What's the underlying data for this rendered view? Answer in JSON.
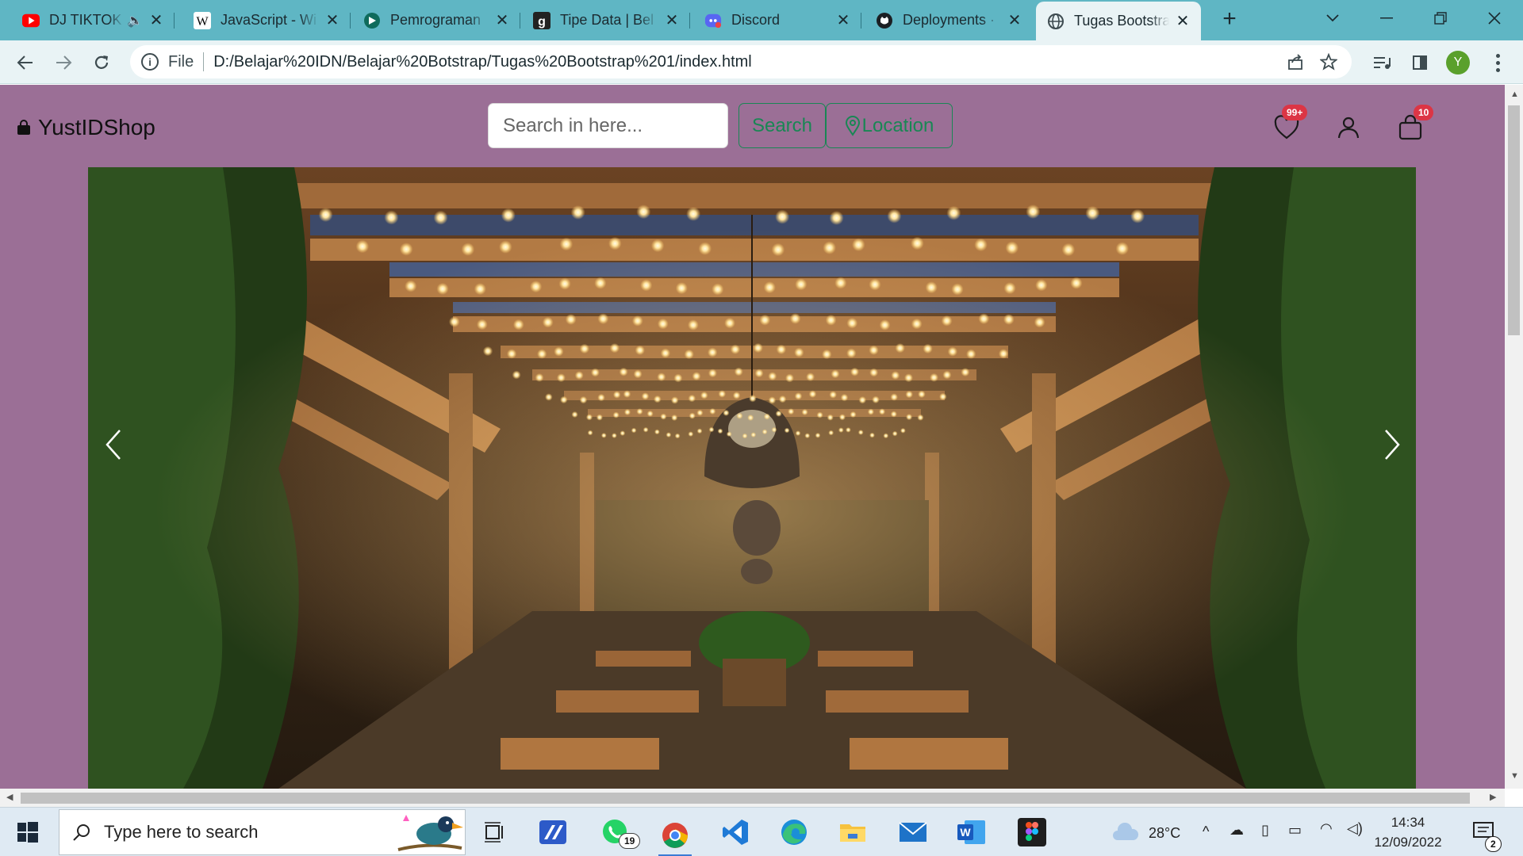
{
  "browser": {
    "tabs": [
      {
        "title": "DJ TIKTOK",
        "icon": "youtube-icon",
        "muted_indicator": true,
        "active": false
      },
      {
        "title": "JavaScript - Wi",
        "icon": "wikipedia-icon",
        "active": false
      },
      {
        "title": "Pemrograman",
        "icon": "teal-site-icon",
        "active": false
      },
      {
        "title": "Tipe Data | Bel",
        "icon": "g-site-icon",
        "active": false
      },
      {
        "title": "Discord",
        "icon": "discord-icon",
        "active": false
      },
      {
        "title": "Deployments ·",
        "icon": "github-icon",
        "active": false
      },
      {
        "title": "Tugas Bootstra",
        "icon": "globe-icon",
        "active": true
      }
    ],
    "address": {
      "scheme_label": "File",
      "url": "D:/Belajar%20IDN/Belajar%20Botstrap/Tugas%20Bootstrap%201/index.html"
    },
    "profile_initial": "Y"
  },
  "page": {
    "brand": "YustIDShop",
    "search": {
      "placeholder": "Search in here...",
      "button": "Search"
    },
    "location_button": "Location",
    "wishlist_badge": "99+",
    "cart_badge": "10",
    "colors": {
      "page_bg": "#9b6f96",
      "accent": "#198754",
      "badge": "#dc3545"
    }
  },
  "taskbar": {
    "search_placeholder": "Type here to search",
    "whatsapp_badge": "19",
    "weather": "28°C",
    "time": "14:34",
    "date": "12/09/2022",
    "notifications": "2"
  }
}
